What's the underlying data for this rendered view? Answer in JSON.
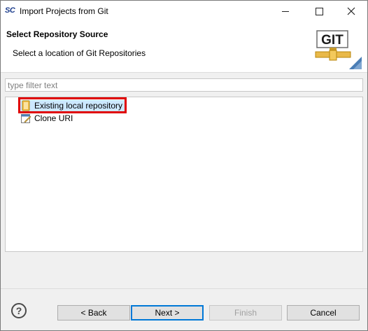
{
  "window": {
    "app_icon_text": "SC",
    "title": "Import Projects from Git"
  },
  "header": {
    "title": "Select Repository Source",
    "subtitle": "Select a location of Git Repositories",
    "logo_text": "GIT"
  },
  "filter": {
    "placeholder": "type filter text",
    "value": ""
  },
  "tree": {
    "items": [
      {
        "label": "Existing local repository",
        "icon": "repository-icon",
        "selected": true
      },
      {
        "label": "Clone URI",
        "icon": "clone-uri-icon",
        "selected": false
      }
    ]
  },
  "buttons": {
    "help": "?",
    "back": "< Back",
    "next": "Next >",
    "finish": "Finish",
    "cancel": "Cancel"
  },
  "colors": {
    "selection": "#cce8ff",
    "highlight": "#e00000",
    "default_button_border": "#0078d7"
  }
}
